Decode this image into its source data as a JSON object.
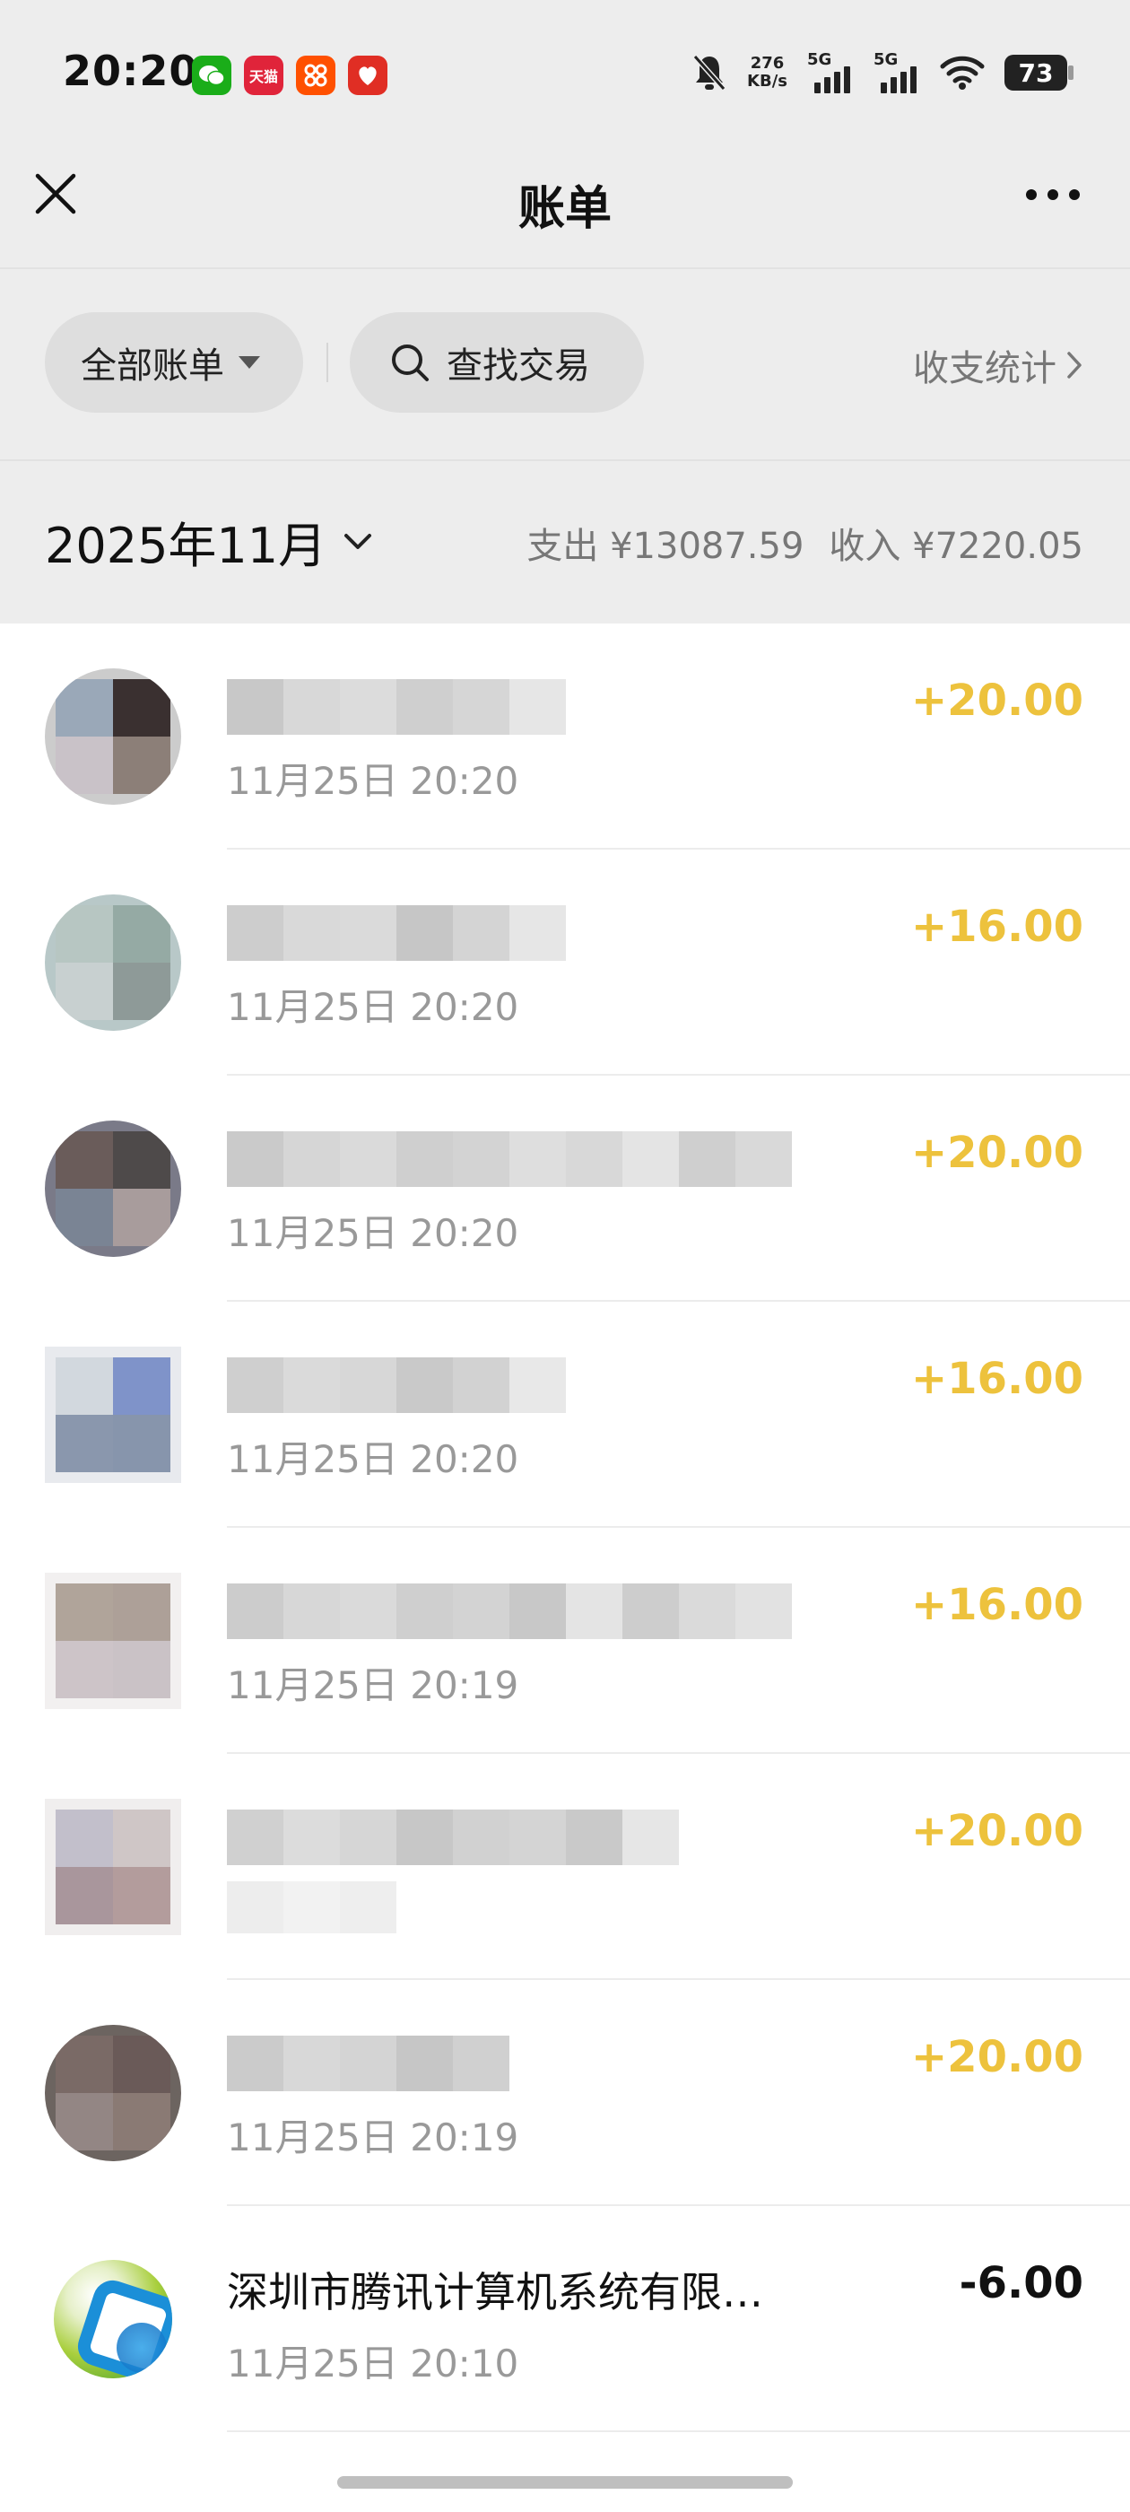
{
  "status_bar": {
    "time": "20:20",
    "apps": [
      {
        "name": "wechat-icon",
        "label": "",
        "color": "#1aad19"
      },
      {
        "name": "tmall-icon",
        "label": "天猫",
        "color": "#e0243a"
      },
      {
        "name": "taobao-icon",
        "label": "",
        "color": "#ff5000"
      },
      {
        "name": "pinduoduo-icon",
        "label": "",
        "color": "#e02e24"
      }
    ],
    "net_speed_value": "276",
    "net_speed_unit": "KB/s",
    "signal_1_label": "5G",
    "signal_2_label": "5G",
    "battery": "73"
  },
  "nav": {
    "title": "账单"
  },
  "filters": {
    "all_bills": "全部账单",
    "search": "查找交易",
    "stats": "收支统计"
  },
  "month": {
    "label": "2025年11月",
    "expense": "支出 ¥13087.59",
    "income": "收入 ¥7220.05"
  },
  "transactions": [
    {
      "title": "",
      "time": "11月25日 20:20",
      "amount": "+20.00"
    },
    {
      "title": "",
      "time": "11月25日 20:20",
      "amount": "+16.00"
    },
    {
      "title": "",
      "time": "11月25日 20:20",
      "amount": "+20.00"
    },
    {
      "title": "",
      "time": "11月25日 20:20",
      "amount": "+16.00"
    },
    {
      "title": "",
      "time": "11月25日 20:19",
      "amount": "+16.00"
    },
    {
      "title": "",
      "time": "",
      "amount": "+20.00"
    },
    {
      "title": "",
      "time": "11月25日 20:19",
      "amount": "+20.00"
    },
    {
      "title": "深圳市腾讯计算机系统有限…",
      "time": "11月25日 20:10",
      "amount": "-6.00"
    }
  ],
  "colors": {
    "income": "#edc23d",
    "expense": "#111111",
    "header_bg": "#ededed"
  }
}
